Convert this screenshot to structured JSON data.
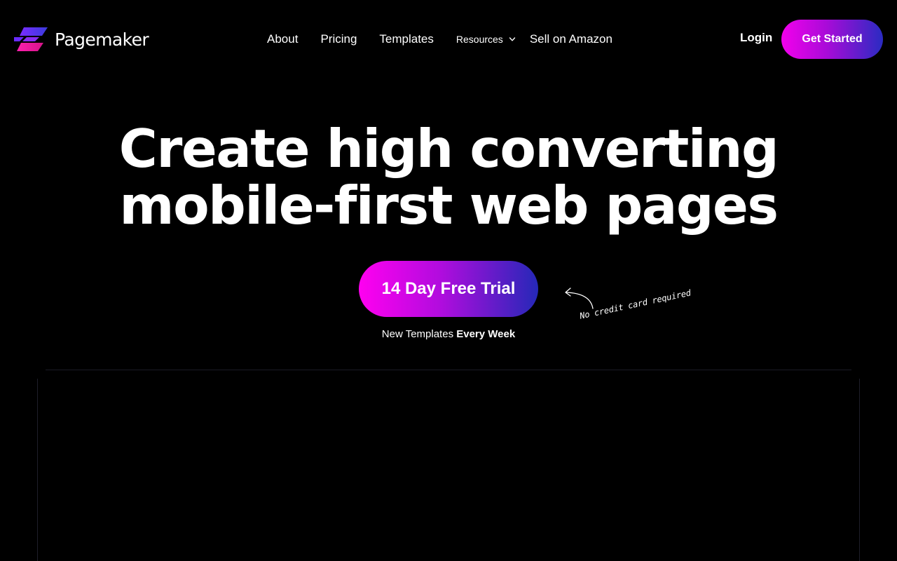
{
  "brand": {
    "name": "Pagemaker",
    "colors": {
      "magenta": "#f300ec",
      "violet": "#a80bd8",
      "indigo": "#2a2bc2",
      "background": "#000000"
    }
  },
  "nav": {
    "about": "About",
    "pricing": "Pricing",
    "templates": "Templates",
    "resources": "Resources",
    "sell": "Sell on Amazon"
  },
  "header": {
    "login": "Login",
    "get_started": "Get Started"
  },
  "hero": {
    "title_line1": "Create high converting",
    "title_line2": "mobile-first web pages",
    "cta": "14 Day Free Trial",
    "sub_prefix": "New Templates ",
    "sub_bold": "Every Week",
    "note": "No credit card required"
  },
  "icons": {
    "logo": "pagemaker-logo-icon",
    "resources_chevron": "chevron-down-icon",
    "note_arrow": "curved-arrow-icon"
  }
}
